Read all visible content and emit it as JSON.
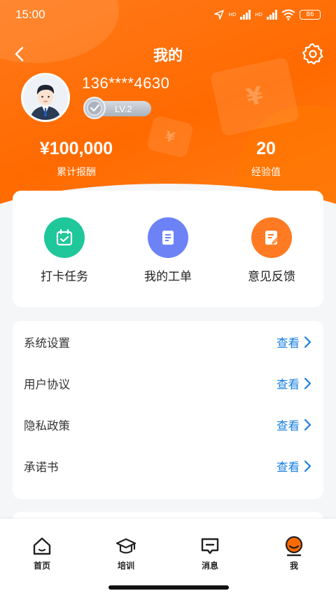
{
  "status_bar": {
    "time": "15:00",
    "battery": "86",
    "net1": "HD",
    "net2": "HD"
  },
  "nav": {
    "title": "我的"
  },
  "profile": {
    "phone": "136****4630",
    "level": "LV.2"
  },
  "stats": [
    {
      "value": "¥100,000",
      "label": "累计报酬"
    },
    {
      "value": "20",
      "label": "经验值"
    }
  ],
  "quick_actions": [
    {
      "label": "打卡任务",
      "icon": "calendar-check-icon",
      "color": "#1fc79b"
    },
    {
      "label": "我的工单",
      "icon": "document-icon",
      "color": "#6c82f5"
    },
    {
      "label": "意见反馈",
      "icon": "edit-note-icon",
      "color": "#ff7a22"
    }
  ],
  "menu": {
    "view_label": "查看",
    "items": [
      {
        "label": "系统设置"
      },
      {
        "label": "用户协议"
      },
      {
        "label": "隐私政策"
      },
      {
        "label": "承诺书"
      }
    ]
  },
  "ticket_symbol": "¥",
  "tabbar": {
    "items": [
      {
        "label": "首页",
        "icon": "home-icon"
      },
      {
        "label": "培训",
        "icon": "graduation-cap-icon"
      },
      {
        "label": "消息",
        "icon": "message-icon"
      },
      {
        "label": "我",
        "icon": "profile-icon",
        "active_color": "#ff6a00"
      }
    ]
  },
  "colors": {
    "brand": "#ff6a00",
    "link": "#1a7fe0"
  }
}
